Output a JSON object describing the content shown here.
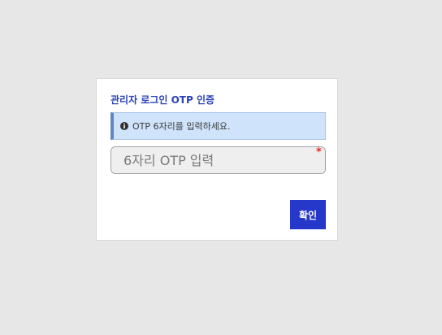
{
  "title": "관리자 로그인 OTP 인증",
  "alert": {
    "icon": "info-circle-icon",
    "message": "OTP 6자리를 입력하세요."
  },
  "otp_input": {
    "value": "",
    "placeholder": "6자리 OTP 입력",
    "required_mark": "*"
  },
  "confirm_button": {
    "label": "확인"
  },
  "colors": {
    "background": "#e7e7e7",
    "title": "#2a43b8",
    "alert_background": "#cfe3fb",
    "alert_border": "#5f86c9",
    "required": "#e02b2b",
    "button": "#2538c9"
  }
}
